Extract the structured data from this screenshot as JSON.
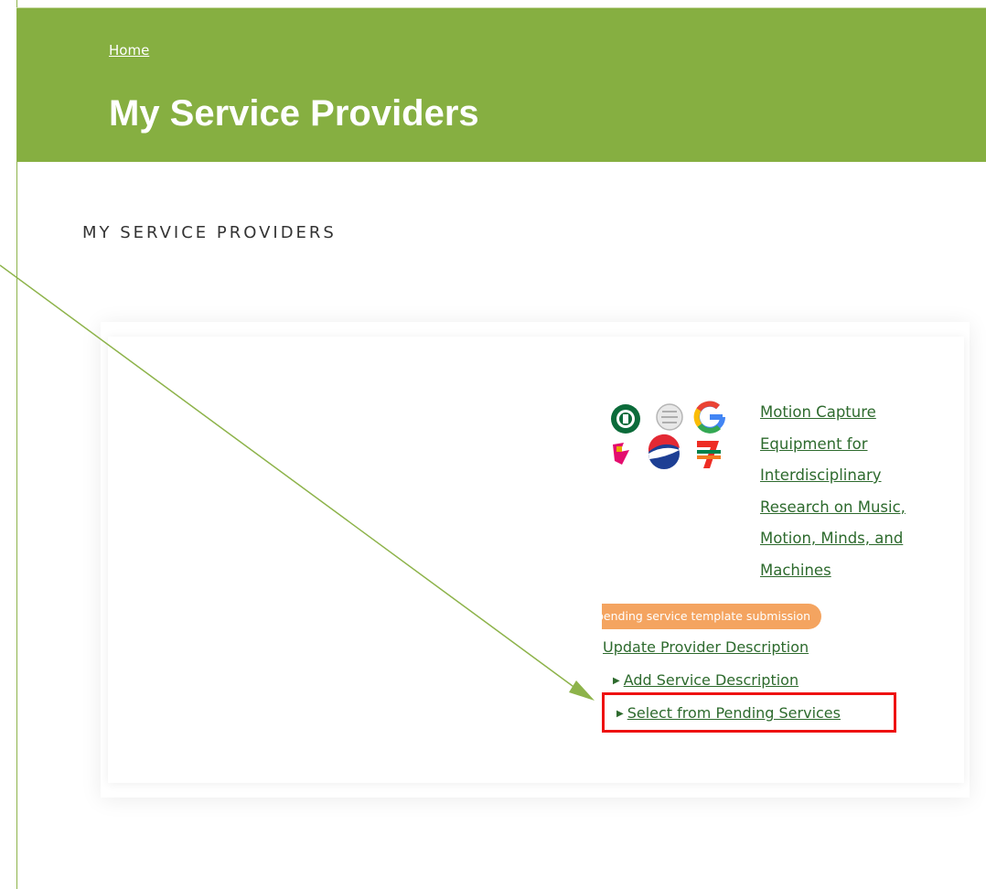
{
  "header": {
    "breadcrumb": "Home",
    "title": "My Service Providers"
  },
  "section": {
    "heading": "MY SERVICE PROVIDERS"
  },
  "provider": {
    "logos": [
      "starbucks-logo",
      "wikipedia-logo",
      "google-logo",
      "olympics-logo",
      "pepsi-logo",
      "seven-eleven-logo"
    ],
    "name_lines": [
      "Motion Capture",
      "Equipment for",
      "Interdisciplinary",
      "Research on Music,",
      "Motion, Minds, and",
      "Machines"
    ],
    "status_badge": "pending service template submission",
    "actions": {
      "update": "Update Provider Description",
      "add_service": "Add Service Description",
      "select_pending": "Select from Pending Services"
    }
  },
  "colors": {
    "header_bg": "#86af41",
    "link": "#2d6a2d",
    "badge": "#f4a460",
    "highlight": "#ee1111",
    "annotation": "#8db34a"
  }
}
